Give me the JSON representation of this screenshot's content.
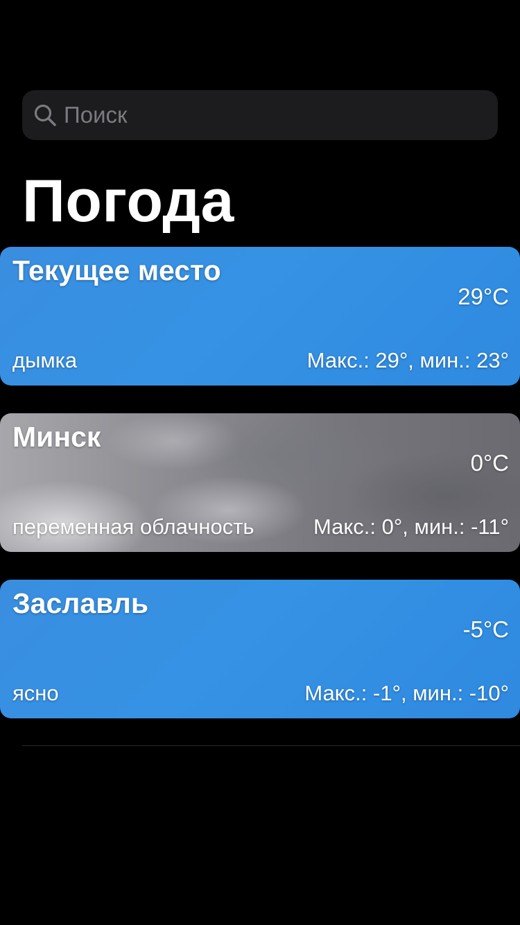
{
  "search": {
    "placeholder": "Поиск"
  },
  "header": {
    "title": "Погода"
  },
  "cities": [
    {
      "name": "Текущее место",
      "temp": "29°C",
      "condition": "дымка",
      "range": "Макс.: 29°, мин.: 23°"
    },
    {
      "name": "Минск",
      "temp": "0°C",
      "condition": "переменная облачность",
      "range": "Макс.: 0°, мин.: -11°"
    },
    {
      "name": "Заславль",
      "temp": "-5°C",
      "condition": "ясно",
      "range": "Макс.: -1°, мин.: -10°"
    }
  ],
  "icons": {
    "search": "search-icon"
  },
  "colors": {
    "background": "#000000",
    "search_bg": "#1c1c1e",
    "clear_sky": "#3592e4",
    "cloudy_sky": "#8a8a90"
  }
}
